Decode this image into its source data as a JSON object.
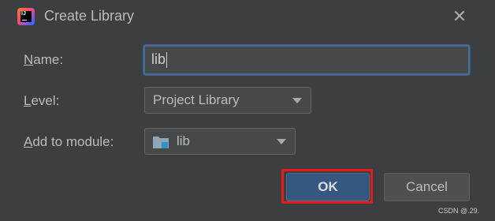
{
  "title": "Create Library",
  "close_icon": "close-icon",
  "app_icon_text": "IJ",
  "fields": {
    "name_label_accel": "N",
    "name_label_rest": "ame:",
    "name_value": "lib",
    "level_label_accel": "L",
    "level_label_rest": "evel:",
    "level_value": "Project Library",
    "module_label_accel": "A",
    "module_label_rest": "dd to module:",
    "module_value": "lib"
  },
  "buttons": {
    "ok": "OK",
    "cancel": "Cancel"
  },
  "highlight_color": "#e81a1a",
  "watermark": "CSDN @.29."
}
